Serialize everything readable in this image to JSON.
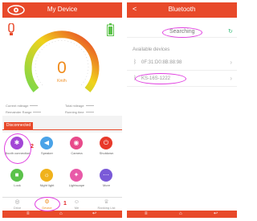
{
  "left": {
    "header": {
      "title": "My Device"
    },
    "speed": {
      "value": "0",
      "unit": "Km/h"
    },
    "stats": {
      "current_mileage": "Current mileage",
      "total_mileage": "Total mileage",
      "remainder_range": "Remainder Range",
      "running_time": "Running time"
    },
    "status_tab": "Disconnected",
    "controls": [
      {
        "label": "Blooth connection",
        "icon": "bluetooth-icon",
        "color": "#a347d6"
      },
      {
        "label": "Speaker",
        "icon": "speaker-icon",
        "color": "#4aa3e8"
      },
      {
        "label": "Camera",
        "icon": "camera-icon",
        "color": "#e84a8a"
      },
      {
        "label": "Shutdown",
        "icon": "power-icon",
        "color": "#e8392a"
      },
      {
        "label": "Lock",
        "icon": "lock-icon",
        "color": "#5bc24a"
      },
      {
        "label": "Night light",
        "icon": "night-light-icon",
        "color": "#f0b21c"
      },
      {
        "label": "Lightscape",
        "icon": "lightscape-icon",
        "color": "#e85aa8"
      },
      {
        "label": "More",
        "icon": "more-icon",
        "color": "#7a5ad8"
      }
    ],
    "tabs": [
      {
        "label": "Drive",
        "icon": "drive-icon"
      },
      {
        "label": "Device",
        "icon": "device-icon"
      },
      {
        "label": "Me",
        "icon": "me-icon"
      },
      {
        "label": "Ranking List",
        "icon": "ranking-icon"
      }
    ],
    "annotations": {
      "step1": "1",
      "step2": "2"
    }
  },
  "right": {
    "header": {
      "title": "Bluetooth",
      "back": "<"
    },
    "searching": "Searching",
    "available_label": "Available devices",
    "devices": [
      {
        "name": "0F:31:D0:8B:88:98"
      },
      {
        "name": "KS-16S-1222"
      }
    ]
  },
  "colors": {
    "accent": "#e8492a",
    "highlight": "#e040e0",
    "speed": "#f08b1c"
  }
}
